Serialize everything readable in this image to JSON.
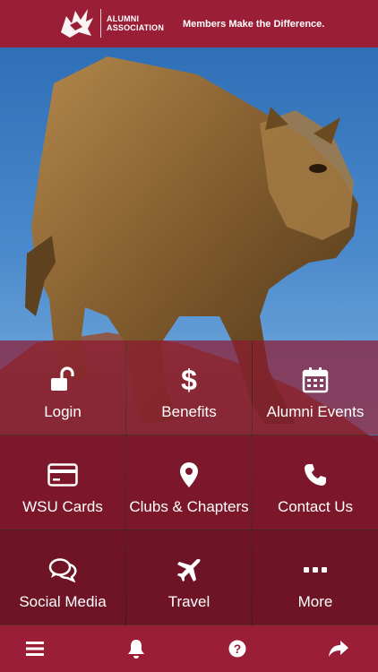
{
  "header": {
    "org_line1": "ALUMNI",
    "org_line2": "ASSOCIATION",
    "tagline": "Members Make the Difference."
  },
  "menu": [
    {
      "label": "Login",
      "icon": "unlock-icon"
    },
    {
      "label": "Benefits",
      "icon": "dollar-icon"
    },
    {
      "label": "Alumni Events",
      "icon": "calendar-icon"
    },
    {
      "label": "WSU Cards",
      "icon": "credit-card-icon"
    },
    {
      "label": "Clubs & Chapters",
      "icon": "map-marker-icon"
    },
    {
      "label": "Contact Us",
      "icon": "phone-icon"
    },
    {
      "label": "Social Media",
      "icon": "chat-bubbles-icon"
    },
    {
      "label": "Travel",
      "icon": "airplane-icon"
    },
    {
      "label": "More",
      "icon": "ellipsis-icon"
    }
  ],
  "bottom_bar": [
    "menu-icon",
    "bell-icon",
    "help-icon",
    "share-icon"
  ],
  "colors": {
    "header": "#9a1e36",
    "tile": "#7d142a",
    "sky": "#4a89cc",
    "bronze": "#8a6232"
  }
}
